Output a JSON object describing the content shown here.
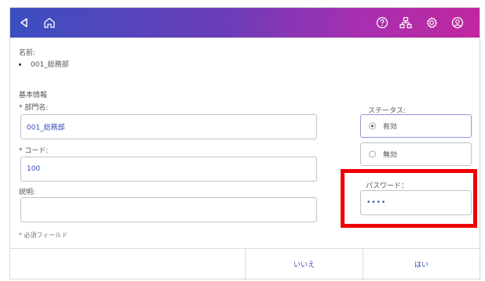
{
  "colors": {
    "accent": "#3a4bb8",
    "highlight": "#ee0000",
    "header_start": "#3b4fc0",
    "header_end": "#c0279e"
  },
  "header": {
    "icons": [
      "back-icon",
      "home-icon",
      "help-icon",
      "network-icon",
      "gear-icon",
      "account-icon"
    ]
  },
  "name_section": {
    "label": "名前:",
    "value": "001_総務部"
  },
  "basic_info": {
    "heading": "基本情報"
  },
  "department": {
    "label": "* 部門名:",
    "value": "001_総務部"
  },
  "code": {
    "label": "* コード:",
    "value": "100"
  },
  "description": {
    "label": "説明:",
    "value": ""
  },
  "status": {
    "label": "ステータス:",
    "options": [
      {
        "label": "有効",
        "selected": true
      },
      {
        "label": "無効",
        "selected": false
      }
    ]
  },
  "password": {
    "label": "パスワード：",
    "value": "••••"
  },
  "required_note": "* 必須フィールド",
  "footer": {
    "no_label": "いいえ",
    "yes_label": "はい"
  }
}
